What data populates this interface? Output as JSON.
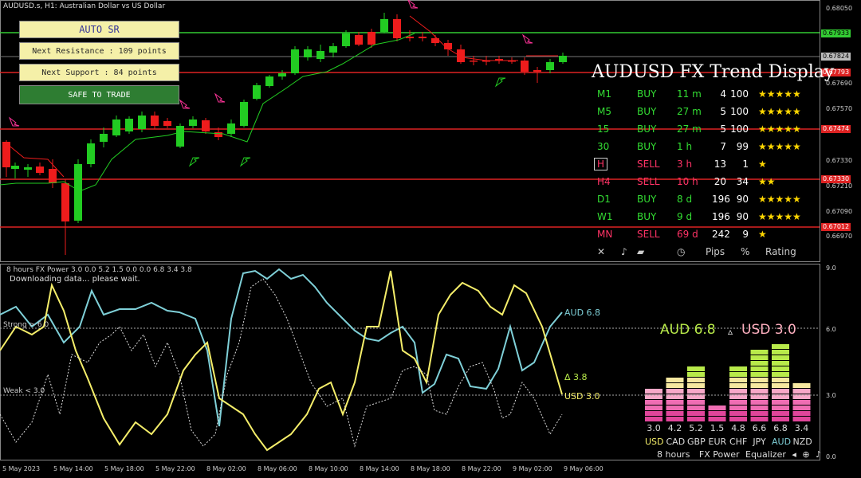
{
  "window": {
    "title": "AUDUSD.s, H1:  Australian Dollar vs US Dollar"
  },
  "price_axis": {
    "labels": [
      "0.68050",
      "0.67933",
      "0.67824",
      "0.67793",
      "0.67690",
      "0.67570",
      "0.67474",
      "0.67330",
      "0.67210",
      "0.67090",
      "0.67012",
      "0.66970"
    ],
    "tags": [
      {
        "text": "0.67933",
        "color": "#33cc33"
      },
      {
        "text": "0.67824",
        "color": "#bbbbbb"
      },
      {
        "text": "0.67793",
        "color": "#dd2222"
      },
      {
        "text": "0.67474",
        "color": "#dd2222"
      },
      {
        "text": "0.67330",
        "color": "#dd2222"
      },
      {
        "text": "0.67012",
        "color": "#dd2222"
      }
    ]
  },
  "auto_sr": {
    "title": "AUTO SR",
    "next_resistance": "Next Resistance : 109 points",
    "next_support": "Next Support : 84 points",
    "safe_button": "SAFE TO TRADE",
    "colors": {
      "box": "#f5f0a8",
      "safe": "#2e7d32"
    }
  },
  "trend_display": {
    "title": "AUDUSD FX Trend Display",
    "rows": [
      {
        "tf": "M1",
        "dir": "BUY",
        "time": "11 m",
        "pips": "4",
        "pct": "100",
        "rating": "★★★★★",
        "color": "#33dd33"
      },
      {
        "tf": "M5",
        "dir": "BUY",
        "time": "27 m",
        "pips": "5",
        "pct": "100",
        "rating": "★★★★★",
        "color": "#33dd33"
      },
      {
        "tf": "15",
        "dir": "BUY",
        "time": "27 m",
        "pips": "5",
        "pct": "100",
        "rating": "★★★★★",
        "color": "#33dd33"
      },
      {
        "tf": "30",
        "dir": "BUY",
        "time": "1 h",
        "pips": "7",
        "pct": "99",
        "rating": "★★★★★",
        "color": "#33dd33"
      },
      {
        "tf": "H",
        "dir": "SELL",
        "time": "3 h",
        "pips": "13",
        "pct": "1",
        "rating": "★",
        "color": "#ff3366"
      },
      {
        "tf": "H4",
        "dir": "SELL",
        "time": "10 h",
        "pips": "20",
        "pct": "34",
        "rating": "★★",
        "color": "#ff3366"
      },
      {
        "tf": "D1",
        "dir": "BUY",
        "time": "8 d",
        "pips": "196",
        "pct": "90",
        "rating": "★★★★★",
        "color": "#33dd33"
      },
      {
        "tf": "W1",
        "dir": "BUY",
        "time": "9 d",
        "pips": "196",
        "pct": "90",
        "rating": "★★★★★",
        "color": "#33dd33"
      },
      {
        "tf": "MN",
        "dir": "SELL",
        "time": "69 d",
        "pips": "242",
        "pct": "9",
        "rating": "★",
        "color": "#ff3366"
      }
    ],
    "footer": {
      "close": "✕",
      "sound": "♪",
      "chart": "▰",
      "clock": "◷",
      "pips": "Pips",
      "pct": "%",
      "rating": "Rating"
    }
  },
  "fx_power": {
    "title": "8 hours FX Power 3.0 0.0 5.2 1.5 0.0 0.0 6.8 3.4 3.8",
    "message": "Downloading data... please wait.",
    "strong_label": "Strong > 6.0",
    "weak_label": "Weak < 3.0",
    "aud_label": "AUD 6.8",
    "usd_label": "USD 3.0",
    "delta_label": "Δ 3.8",
    "big_aud": "AUD 6.8",
    "big_delta": "▵",
    "big_usd": "USD 3.0",
    "axis": [
      "9.0",
      "6.0",
      "3.0",
      "0.0"
    ],
    "equalizer": {
      "values": [
        "3.0",
        "4.2",
        "5.2",
        "1.5",
        "4.8",
        "6.6",
        "6.8",
        "3.4"
      ],
      "levels": [
        3.0,
        4.2,
        5.2,
        1.5,
        4.8,
        6.6,
        6.8,
        3.4
      ],
      "currencies": [
        "USD",
        "CAD",
        "GBP",
        "EUR",
        "CHF",
        "JPY",
        "AUD",
        "NZD"
      ],
      "footer": {
        "hours": "8 hours",
        "power": "FX Power",
        "eq": "Equalizer",
        "a": "◂",
        "b": "⊕",
        "c": "♪"
      }
    }
  },
  "time_axis": [
    "5 May 2023",
    "5 May 14:00",
    "5 May 18:00",
    "5 May 22:00",
    "8 May 02:00",
    "8 May 06:00",
    "8 May 10:00",
    "8 May 14:00",
    "8 May 18:00",
    "8 May 22:00",
    "9 May 02:00",
    "9 May 06:00"
  ]
}
